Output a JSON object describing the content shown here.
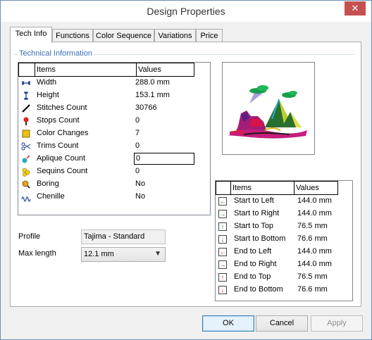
{
  "window": {
    "title": "Design Properties",
    "close_glyph": "✕"
  },
  "tabs": [
    {
      "label": "Tech Info"
    },
    {
      "label": "Functions"
    },
    {
      "label": "Color Sequence"
    },
    {
      "label": "Variations"
    },
    {
      "label": "Price"
    }
  ],
  "tech": {
    "group_title": "Technical Information",
    "headers": {
      "items": "Items",
      "values": "Values"
    },
    "rows": [
      {
        "icon": "width-icon",
        "label": "Width",
        "value": "288.0 mm"
      },
      {
        "icon": "height-icon",
        "label": "Height",
        "value": "153.1 mm"
      },
      {
        "icon": "needle-icon",
        "label": "Stitches Count",
        "value": "30766"
      },
      {
        "icon": "stop-icon",
        "label": "Stops Count",
        "value": "0"
      },
      {
        "icon": "color-change-icon",
        "label": "Color Changes",
        "value": "7"
      },
      {
        "icon": "scissors-icon",
        "label": "Trims Count",
        "value": "0"
      },
      {
        "icon": "applique-icon",
        "label": "Aplique Count",
        "value": "0"
      },
      {
        "icon": "sequin-icon",
        "label": "Sequins Count",
        "value": "0"
      },
      {
        "icon": "boring-icon",
        "label": "Boring",
        "value": "No"
      },
      {
        "icon": "chenille-icon",
        "label": "Chenille",
        "value": "No"
      }
    ]
  },
  "profile": {
    "label": "Profile",
    "value": "Tajima - Standard"
  },
  "max_length": {
    "label": "Max length",
    "value": "12.1 mm"
  },
  "offsets": {
    "headers": {
      "items": "Items",
      "values": "Values"
    },
    "rows": [
      {
        "icon": "start-left-icon",
        "glyph": "←",
        "color": "green",
        "label": "Start to Left",
        "value": "144.0 mm"
      },
      {
        "icon": "start-right-icon",
        "glyph": "→",
        "color": "green",
        "label": "Start to Right",
        "value": "144.0 mm"
      },
      {
        "icon": "start-top-icon",
        "glyph": "↑",
        "color": "green",
        "label": "Start to Top",
        "value": "76.5 mm"
      },
      {
        "icon": "start-bottom-icon",
        "glyph": "↓",
        "color": "green",
        "label": "Start to Bottom",
        "value": "76.6 mm"
      },
      {
        "icon": "end-left-icon",
        "glyph": "←",
        "color": "red",
        "label": "End to Left",
        "value": "144.0 mm"
      },
      {
        "icon": "end-right-icon",
        "glyph": "→",
        "color": "red",
        "label": "End to Right",
        "value": "144.0 mm"
      },
      {
        "icon": "end-top-icon",
        "glyph": "↑",
        "color": "red",
        "label": "End to Top",
        "value": "76.5 mm"
      },
      {
        "icon": "end-bottom-icon",
        "glyph": "↓",
        "color": "red",
        "label": "End to Bottom",
        "value": "76.6 mm"
      }
    ]
  },
  "buttons": {
    "ok": "OK",
    "cancel": "Cancel",
    "apply": "Apply"
  },
  "colors": {
    "accent": "#3c6fb4",
    "close": "#c75050"
  }
}
